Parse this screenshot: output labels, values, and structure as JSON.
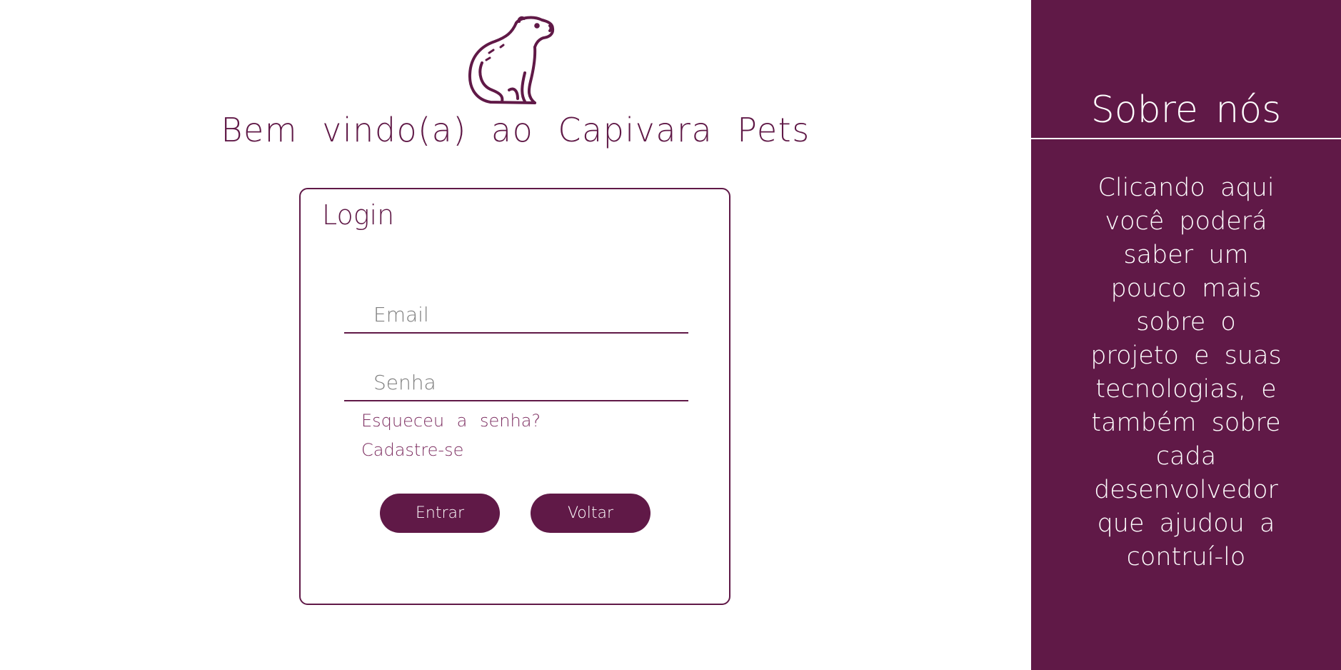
{
  "welcome": {
    "title": "Bem vindo(a) ao Capivara Pets"
  },
  "login": {
    "title": "Login",
    "email_placeholder": "Email",
    "password_placeholder": "Senha",
    "forgot_link": "Esqueceu a senha?",
    "signup_link": "Cadastre-se",
    "enter_button": "Entrar",
    "back_button": "Voltar"
  },
  "sidebar": {
    "title": "Sobre nós",
    "description": "Clicando aqui você poderá saber um pouco mais sobre o projeto e suas tecnologias, e também sobre cada desenvolvedor que ajudou a contruí-lo"
  },
  "colors": {
    "primary": "#601947",
    "background": "#ffffff",
    "placeholder": "#7e7e7e"
  },
  "icons": {
    "logo": "capybara-icon"
  }
}
